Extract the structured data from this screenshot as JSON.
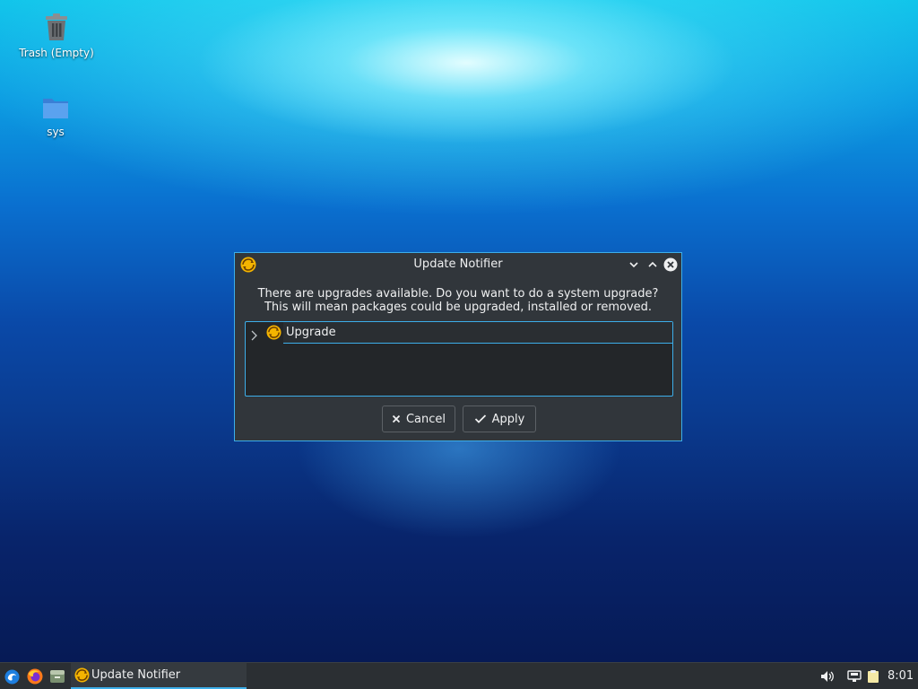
{
  "desktop": {
    "icons": [
      {
        "label": "Trash (Empty)",
        "icon": "trash-icon"
      },
      {
        "label": "sys",
        "icon": "folder-icon"
      }
    ]
  },
  "dialog": {
    "title": "Update Notifier",
    "message_line1": "There are upgrades available. Do you want to do a system upgrade?",
    "message_line2": "This will mean packages could be upgraded, installed or removed.",
    "tree_item": "Upgrade",
    "cancel_label": "Cancel",
    "apply_label": "Apply"
  },
  "taskbar": {
    "task_label": "Update Notifier",
    "clock": "8:01"
  },
  "colors": {
    "accent": "#3daee9",
    "window_bg": "#31363b",
    "panel_bg": "#2b2f33"
  }
}
